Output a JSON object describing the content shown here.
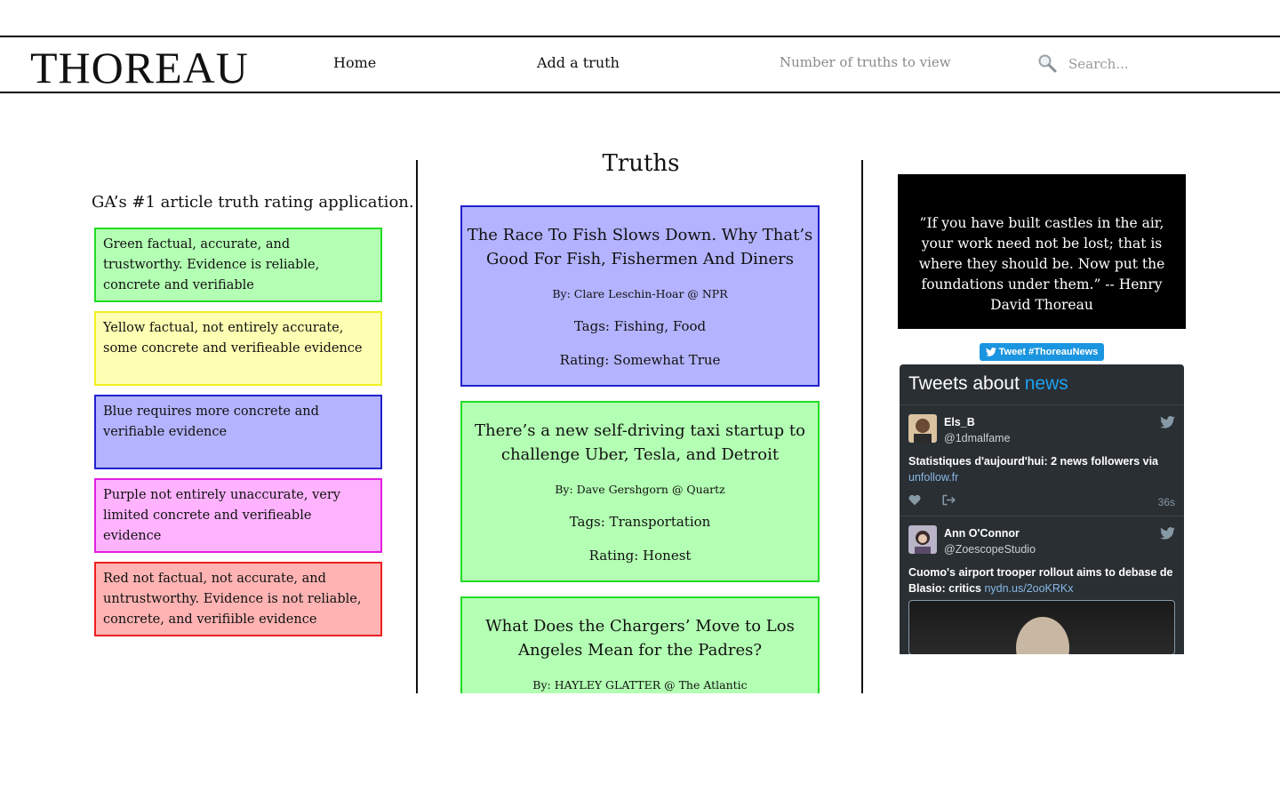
{
  "header": {
    "logo": "THOREAU",
    "nav": {
      "home": "Home",
      "add_truth": "Add a truth",
      "count": "Number of truths to view"
    },
    "search": {
      "placeholder": "Search..."
    }
  },
  "legend": {
    "tagline": "GA’s #1 article truth rating application.",
    "items": [
      {
        "text": "Green factual, accurate, and trustworthy. Evidence is reliable, concrete and verifiable",
        "bg": "#b3ffb3",
        "border": "#22dd22"
      },
      {
        "text": "Yellow factual, not entirely accurate, some concrete and verifieable evidence",
        "bg": "#ffffb3",
        "border": "#f0f020"
      },
      {
        "text": "Blue requires more concrete and verifiable evidence",
        "bg": "#b3b3ff",
        "border": "#2020cc"
      },
      {
        "text": "Purple not entirely unaccurate, very limited concrete and verifieable evidence",
        "bg": "#ffb3ff",
        "border": "#e020e0"
      },
      {
        "text": "Red not factual, not accurate, and untrustworthy. Evidence is not reliable, concrete, and verifiible evidence",
        "bg": "#ffb3b3",
        "border": "#ee2020"
      }
    ]
  },
  "truths": {
    "title": "Truths",
    "cards": [
      {
        "title": "The Race To Fish Slows Down. Why That’s Good For Fish, Fishermen And Diners",
        "byline": "By: Clare Leschin-Hoar @ NPR",
        "tags": "Tags: Fishing, Food",
        "rating": "Rating: Somewhat True",
        "bg": "#b3b3ff",
        "border": "#2020cc"
      },
      {
        "title": "There’s a new self-driving taxi startup to challenge Uber, Tesla, and Detroit",
        "byline": "By: Dave Gershgorn @ Quartz",
        "tags": "Tags: Transportation",
        "rating": "Rating: Honest",
        "bg": "#b3ffb3",
        "border": "#22dd22"
      },
      {
        "title": "What Does the Chargers’ Move to Los Angeles Mean for the Padres?",
        "byline": "By: HAYLEY GLATTER @ The Atlantic",
        "tags": "",
        "rating": "",
        "bg": "#b3ffb3",
        "border": "#22dd22"
      }
    ]
  },
  "quote": {
    "text": "”If you have built castles in the air, your work need not be lost; that is where they should be. Now put the foundations under them.” -- Henry David Thoreau"
  },
  "twitter": {
    "tweet_button": "Tweet #ThoreauNews",
    "heading_prefix": "Tweets about ",
    "heading_accent": "news",
    "tweets": [
      {
        "name": "Els_B",
        "handle": "@1dmalfame",
        "text": "Statistiques d'aujourd'hui: 2 news followers via ",
        "link": "unfollow.fr",
        "time": "36s"
      },
      {
        "name": "Ann O'Connor",
        "handle": "@ZoescopeStudio",
        "text": "Cuomo's airport trooper rollout aims to debase de Blasio: critics ",
        "link": "nydn.us/2ooKRKx",
        "time": ""
      }
    ]
  }
}
